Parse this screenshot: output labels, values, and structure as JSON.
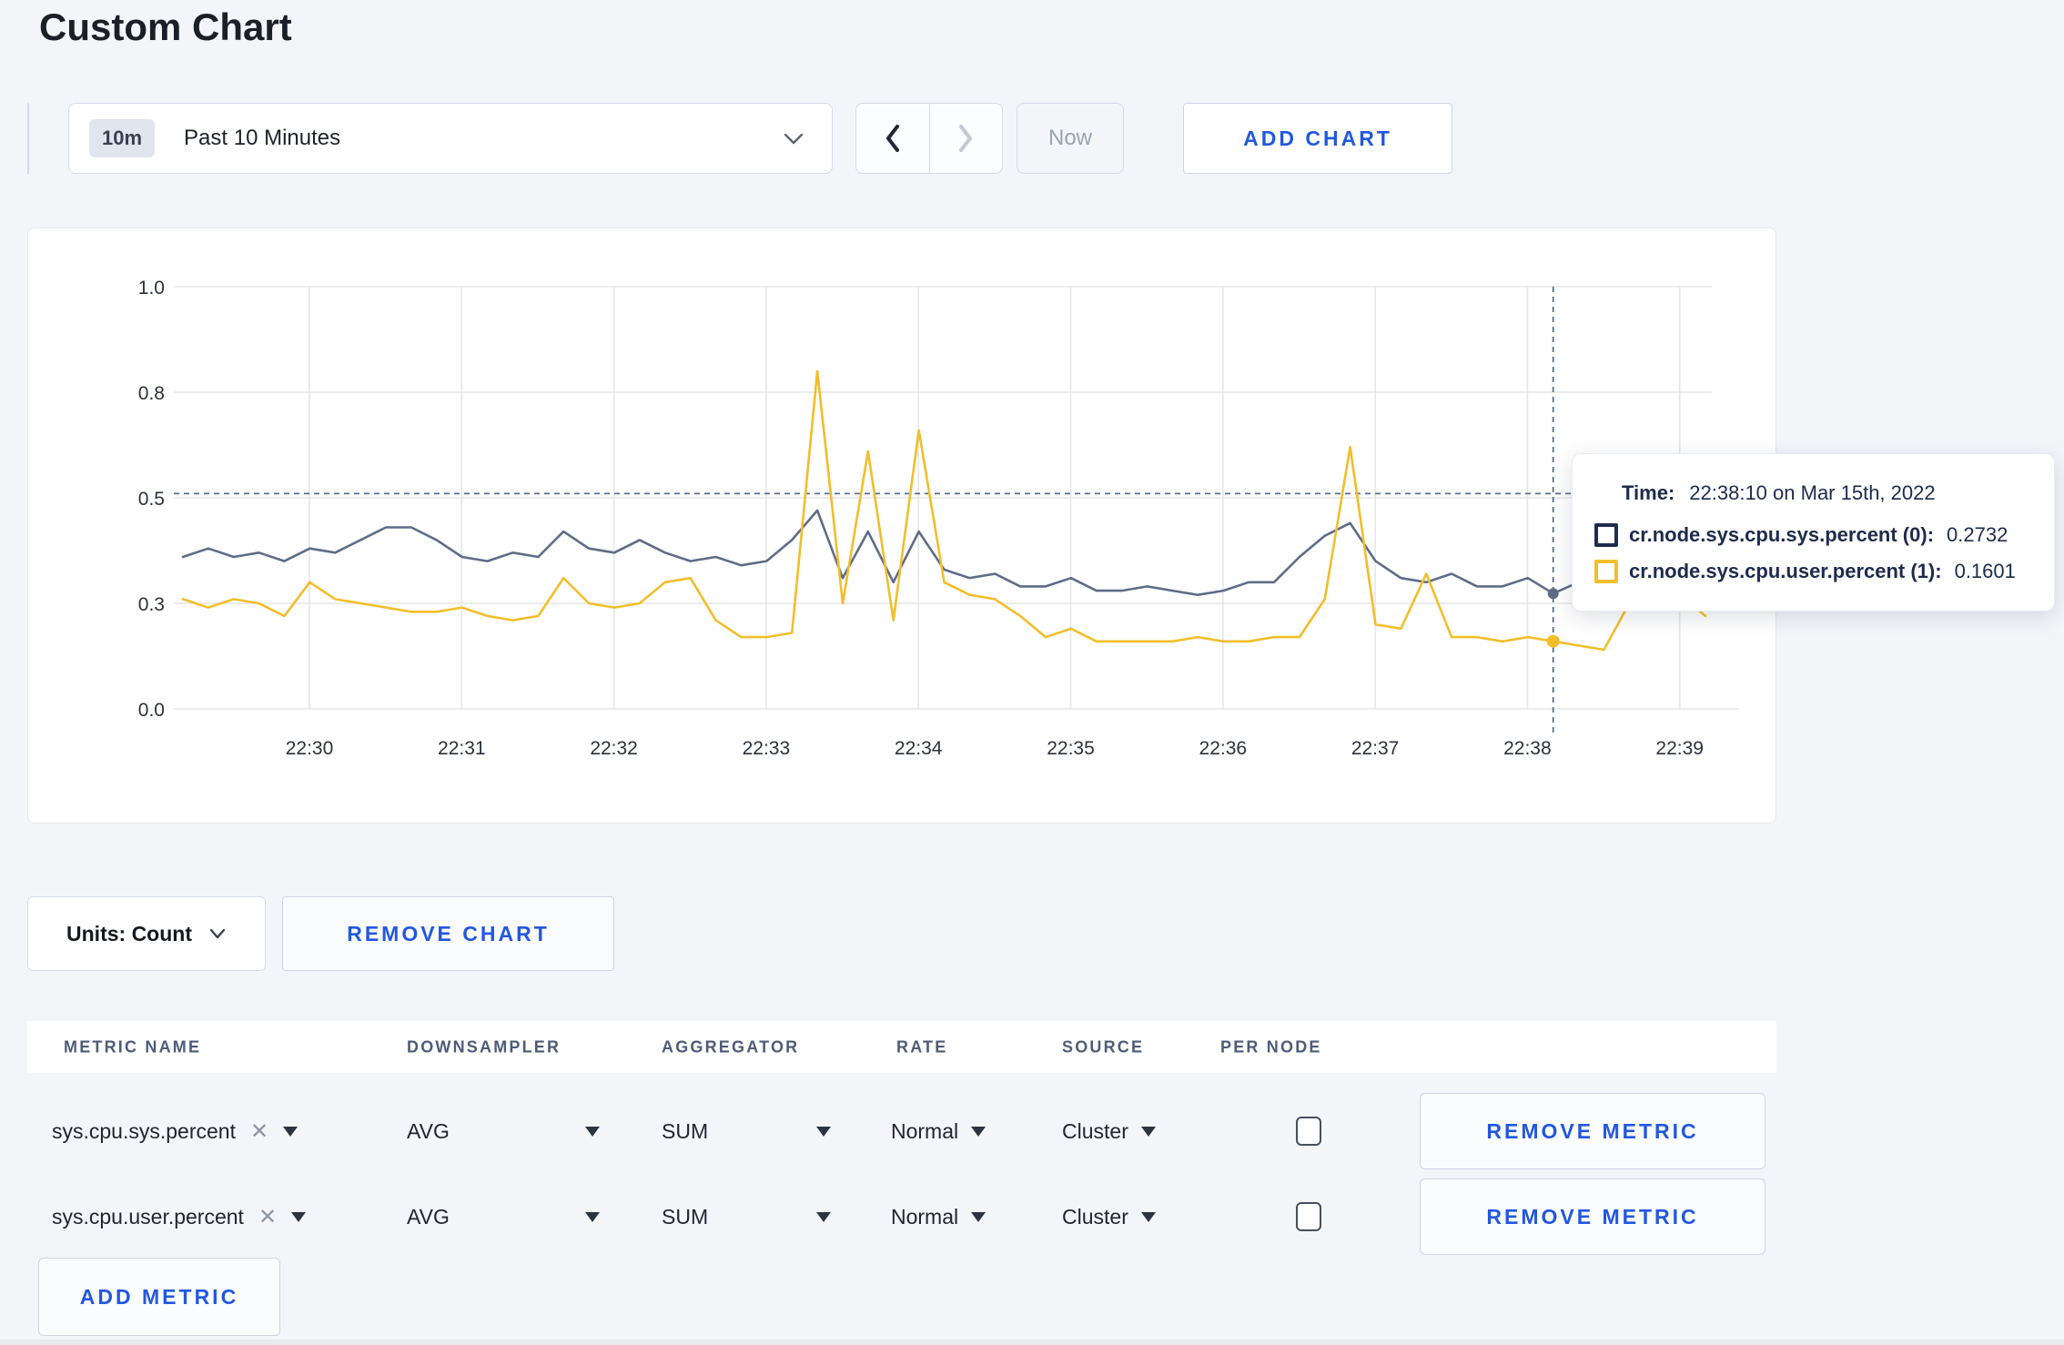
{
  "page": {
    "title": "Custom Chart"
  },
  "colors": {
    "accent_blue": "#2257E0",
    "series_sys": "#5F6C87",
    "series_user": "#F2BE2C",
    "tooltip_sys_swatch": "#1F2D4D",
    "tooltip_user_swatch": "#F2BE2C",
    "gridline": "#e6e6e6",
    "crosshair": "#5a6d90"
  },
  "toolbar": {
    "timeframe_badge": "10m",
    "timeframe_label": "Past 10 Minutes",
    "now_label": "Now",
    "add_chart_label": "ADD CHART"
  },
  "chart_data": {
    "type": "line",
    "title": "",
    "xlabel": "",
    "ylabel": "",
    "x_start": "22:29:10",
    "x_interval_seconds": 10,
    "x_ticks": [
      "22:30",
      "22:31",
      "22:32",
      "22:33",
      "22:34",
      "22:35",
      "22:36",
      "22:37",
      "22:38",
      "22:39"
    ],
    "y_tick_values": [
      0,
      0.25,
      0.5,
      0.75,
      1.0
    ],
    "y_tick_labels": [
      "0.0",
      "0.3",
      "0.5",
      "0.8",
      "1.0"
    ],
    "ylim": [
      0,
      1
    ],
    "grid": true,
    "legend_position": "none",
    "series": [
      {
        "name": "cr.node.sys.cpu.sys.percent (0)",
        "color": "#5F6C87",
        "values": [
          0.36,
          0.38,
          0.36,
          0.37,
          0.35,
          0.38,
          0.37,
          0.4,
          0.43,
          0.43,
          0.4,
          0.36,
          0.35,
          0.37,
          0.36,
          0.42,
          0.38,
          0.37,
          0.4,
          0.37,
          0.35,
          0.36,
          0.34,
          0.35,
          0.4,
          0.47,
          0.31,
          0.42,
          0.3,
          0.42,
          0.33,
          0.31,
          0.32,
          0.29,
          0.29,
          0.31,
          0.28,
          0.28,
          0.29,
          0.28,
          0.27,
          0.28,
          0.3,
          0.3,
          0.36,
          0.41,
          0.44,
          0.35,
          0.31,
          0.3,
          0.32,
          0.29,
          0.29,
          0.31,
          0.2732,
          0.3,
          0.3,
          0.3,
          0.31,
          0.3,
          0.3
        ]
      },
      {
        "name": "cr.node.sys.cpu.user.percent (1)",
        "color": "#F2BE2C",
        "values": [
          0.26,
          0.24,
          0.26,
          0.25,
          0.22,
          0.3,
          0.26,
          0.25,
          0.24,
          0.23,
          0.23,
          0.24,
          0.22,
          0.21,
          0.22,
          0.31,
          0.25,
          0.24,
          0.25,
          0.3,
          0.31,
          0.21,
          0.17,
          0.17,
          0.18,
          0.8,
          0.25,
          0.61,
          0.21,
          0.66,
          0.3,
          0.27,
          0.26,
          0.22,
          0.17,
          0.19,
          0.16,
          0.16,
          0.16,
          0.16,
          0.17,
          0.16,
          0.16,
          0.17,
          0.17,
          0.26,
          0.62,
          0.2,
          0.19,
          0.32,
          0.17,
          0.17,
          0.16,
          0.17,
          0.1601,
          0.15,
          0.14,
          0.25,
          0.3,
          0.27,
          0.22
        ]
      }
    ],
    "crosshair": {
      "index": 54,
      "time": "22:38:10",
      "guide_value": 0.51
    }
  },
  "tooltip": {
    "time_label": "Time:",
    "time_value": "22:38:10 on Mar 15th, 2022",
    "rows": [
      {
        "label": "cr.node.sys.cpu.sys.percent (0):",
        "value": "0.2732"
      },
      {
        "label": "cr.node.sys.cpu.user.percent (1):",
        "value": "0.1601"
      }
    ]
  },
  "chart_footer": {
    "units_label": "Units: Count",
    "remove_chart_label": "REMOVE CHART"
  },
  "metrics_table": {
    "headers": [
      "METRIC NAME",
      "DOWNSAMPLER",
      "AGGREGATOR",
      "RATE",
      "SOURCE",
      "PER NODE"
    ],
    "rows": [
      {
        "metric": "sys.cpu.sys.percent",
        "downsampler": "AVG",
        "aggregator": "SUM",
        "rate": "Normal",
        "source": "Cluster",
        "per_node_checked": false,
        "remove_label": "REMOVE METRIC"
      },
      {
        "metric": "sys.cpu.user.percent",
        "downsampler": "AVG",
        "aggregator": "SUM",
        "rate": "Normal",
        "source": "Cluster",
        "per_node_checked": false,
        "remove_label": "REMOVE METRIC"
      }
    ],
    "add_metric_label": "ADD METRIC"
  }
}
